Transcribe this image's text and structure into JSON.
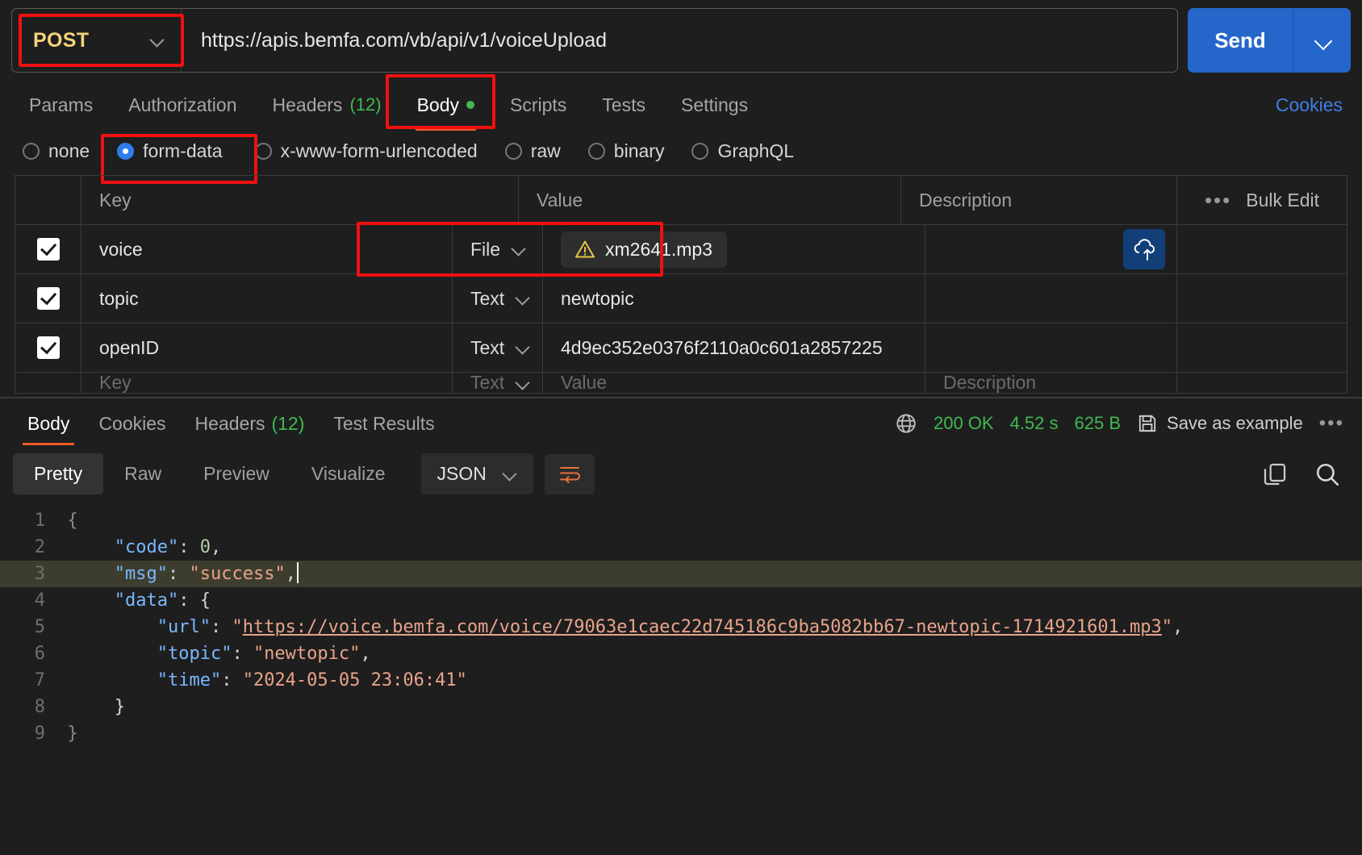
{
  "request": {
    "method": "POST",
    "method_icon": "chevron-down-icon",
    "url": "https://apis.bemfa.com/vb/api/v1/voiceUpload",
    "send_label": "Send",
    "send_caret_icon": "chevron-down-icon"
  },
  "request_tabs": [
    {
      "label": "Params",
      "count": "",
      "active": false,
      "dot": false
    },
    {
      "label": "Authorization",
      "count": "",
      "active": false,
      "dot": false
    },
    {
      "label": "Headers",
      "count": "(12)",
      "active": false,
      "dot": false
    },
    {
      "label": "Body",
      "count": "",
      "active": true,
      "dot": true
    },
    {
      "label": "Scripts",
      "count": "",
      "active": false,
      "dot": false
    },
    {
      "label": "Tests",
      "count": "",
      "active": false,
      "dot": false
    },
    {
      "label": "Settings",
      "count": "",
      "active": false,
      "dot": false
    }
  ],
  "cookies_link": "Cookies",
  "body_types": [
    {
      "label": "none",
      "selected": false
    },
    {
      "label": "form-data",
      "selected": true
    },
    {
      "label": "x-www-form-urlencoded",
      "selected": false
    },
    {
      "label": "raw",
      "selected": false
    },
    {
      "label": "binary",
      "selected": false
    },
    {
      "label": "GraphQL",
      "selected": false
    }
  ],
  "table": {
    "headers": {
      "key": "Key",
      "value": "Value",
      "description": "Description",
      "bulk": "Bulk Edit",
      "more_icon": "more-horizontal-icon"
    },
    "rows": [
      {
        "checked": true,
        "key": "voice",
        "type": "File",
        "value": "xm2641.mp3",
        "is_file": true,
        "warning_icon": "warning-triangle-icon",
        "upload_icon": "cloud-upload-icon",
        "description": ""
      },
      {
        "checked": true,
        "key": "topic",
        "type": "Text",
        "value": "newtopic",
        "is_file": false,
        "description": ""
      },
      {
        "checked": true,
        "key": "openID",
        "type": "Text",
        "value": "4d9ec352e0376f2110a0c601a2857225",
        "is_file": false,
        "description": ""
      }
    ],
    "placeholder_row": {
      "key": "Key",
      "type": "Text",
      "value": "Value",
      "description": "Description"
    }
  },
  "response": {
    "tabs": [
      {
        "label": "Body",
        "count": "",
        "active": true
      },
      {
        "label": "Cookies",
        "count": "",
        "active": false
      },
      {
        "label": "Headers",
        "count": "(12)",
        "active": false
      },
      {
        "label": "Test Results",
        "count": "",
        "active": false
      }
    ],
    "globe_icon": "globe-icon",
    "status": "200 OK",
    "time": "4.52 s",
    "size": "625 B",
    "save_icon": "save-icon",
    "save_label": "Save as example",
    "more_icon": "more-horizontal-icon",
    "view_tabs": [
      {
        "label": "Pretty",
        "active": true
      },
      {
        "label": "Raw",
        "active": false
      },
      {
        "label": "Preview",
        "active": false
      },
      {
        "label": "Visualize",
        "active": false
      }
    ],
    "format": "JSON",
    "format_caret_icon": "chevron-down-icon",
    "wrap_icon": "word-wrap-icon",
    "copy_icon": "copy-icon",
    "search_icon": "search-icon"
  },
  "code": {
    "lines": [
      {
        "n": "1",
        "html": "{"
      },
      {
        "n": "2",
        "html": "code0"
      },
      {
        "n": "3",
        "html": "msgsuccess"
      },
      {
        "n": "4",
        "html": "data"
      },
      {
        "n": "5",
        "html": "url"
      },
      {
        "n": "6",
        "html": "topic"
      },
      {
        "n": "7",
        "html": "time"
      },
      {
        "n": "8",
        "html": "}"
      },
      {
        "n": "9",
        "html": "}"
      }
    ],
    "values": {
      "code_key": "\"code\"",
      "code_val": "0",
      "msg_key": "\"msg\"",
      "msg_val": "\"success\"",
      "data_key": "\"data\"",
      "url_key": "\"url\"",
      "url_val": "https://voice.bemfa.com/voice/79063e1caec22d745186c9ba5082bb67-newtopic-1714921601.mp3",
      "topic_key": "\"topic\"",
      "topic_val": "\"newtopic\"",
      "time_key": "\"time\"",
      "time_val": "\"2024-05-05 23:06:41\""
    }
  },
  "highlight_color": "#f01010"
}
